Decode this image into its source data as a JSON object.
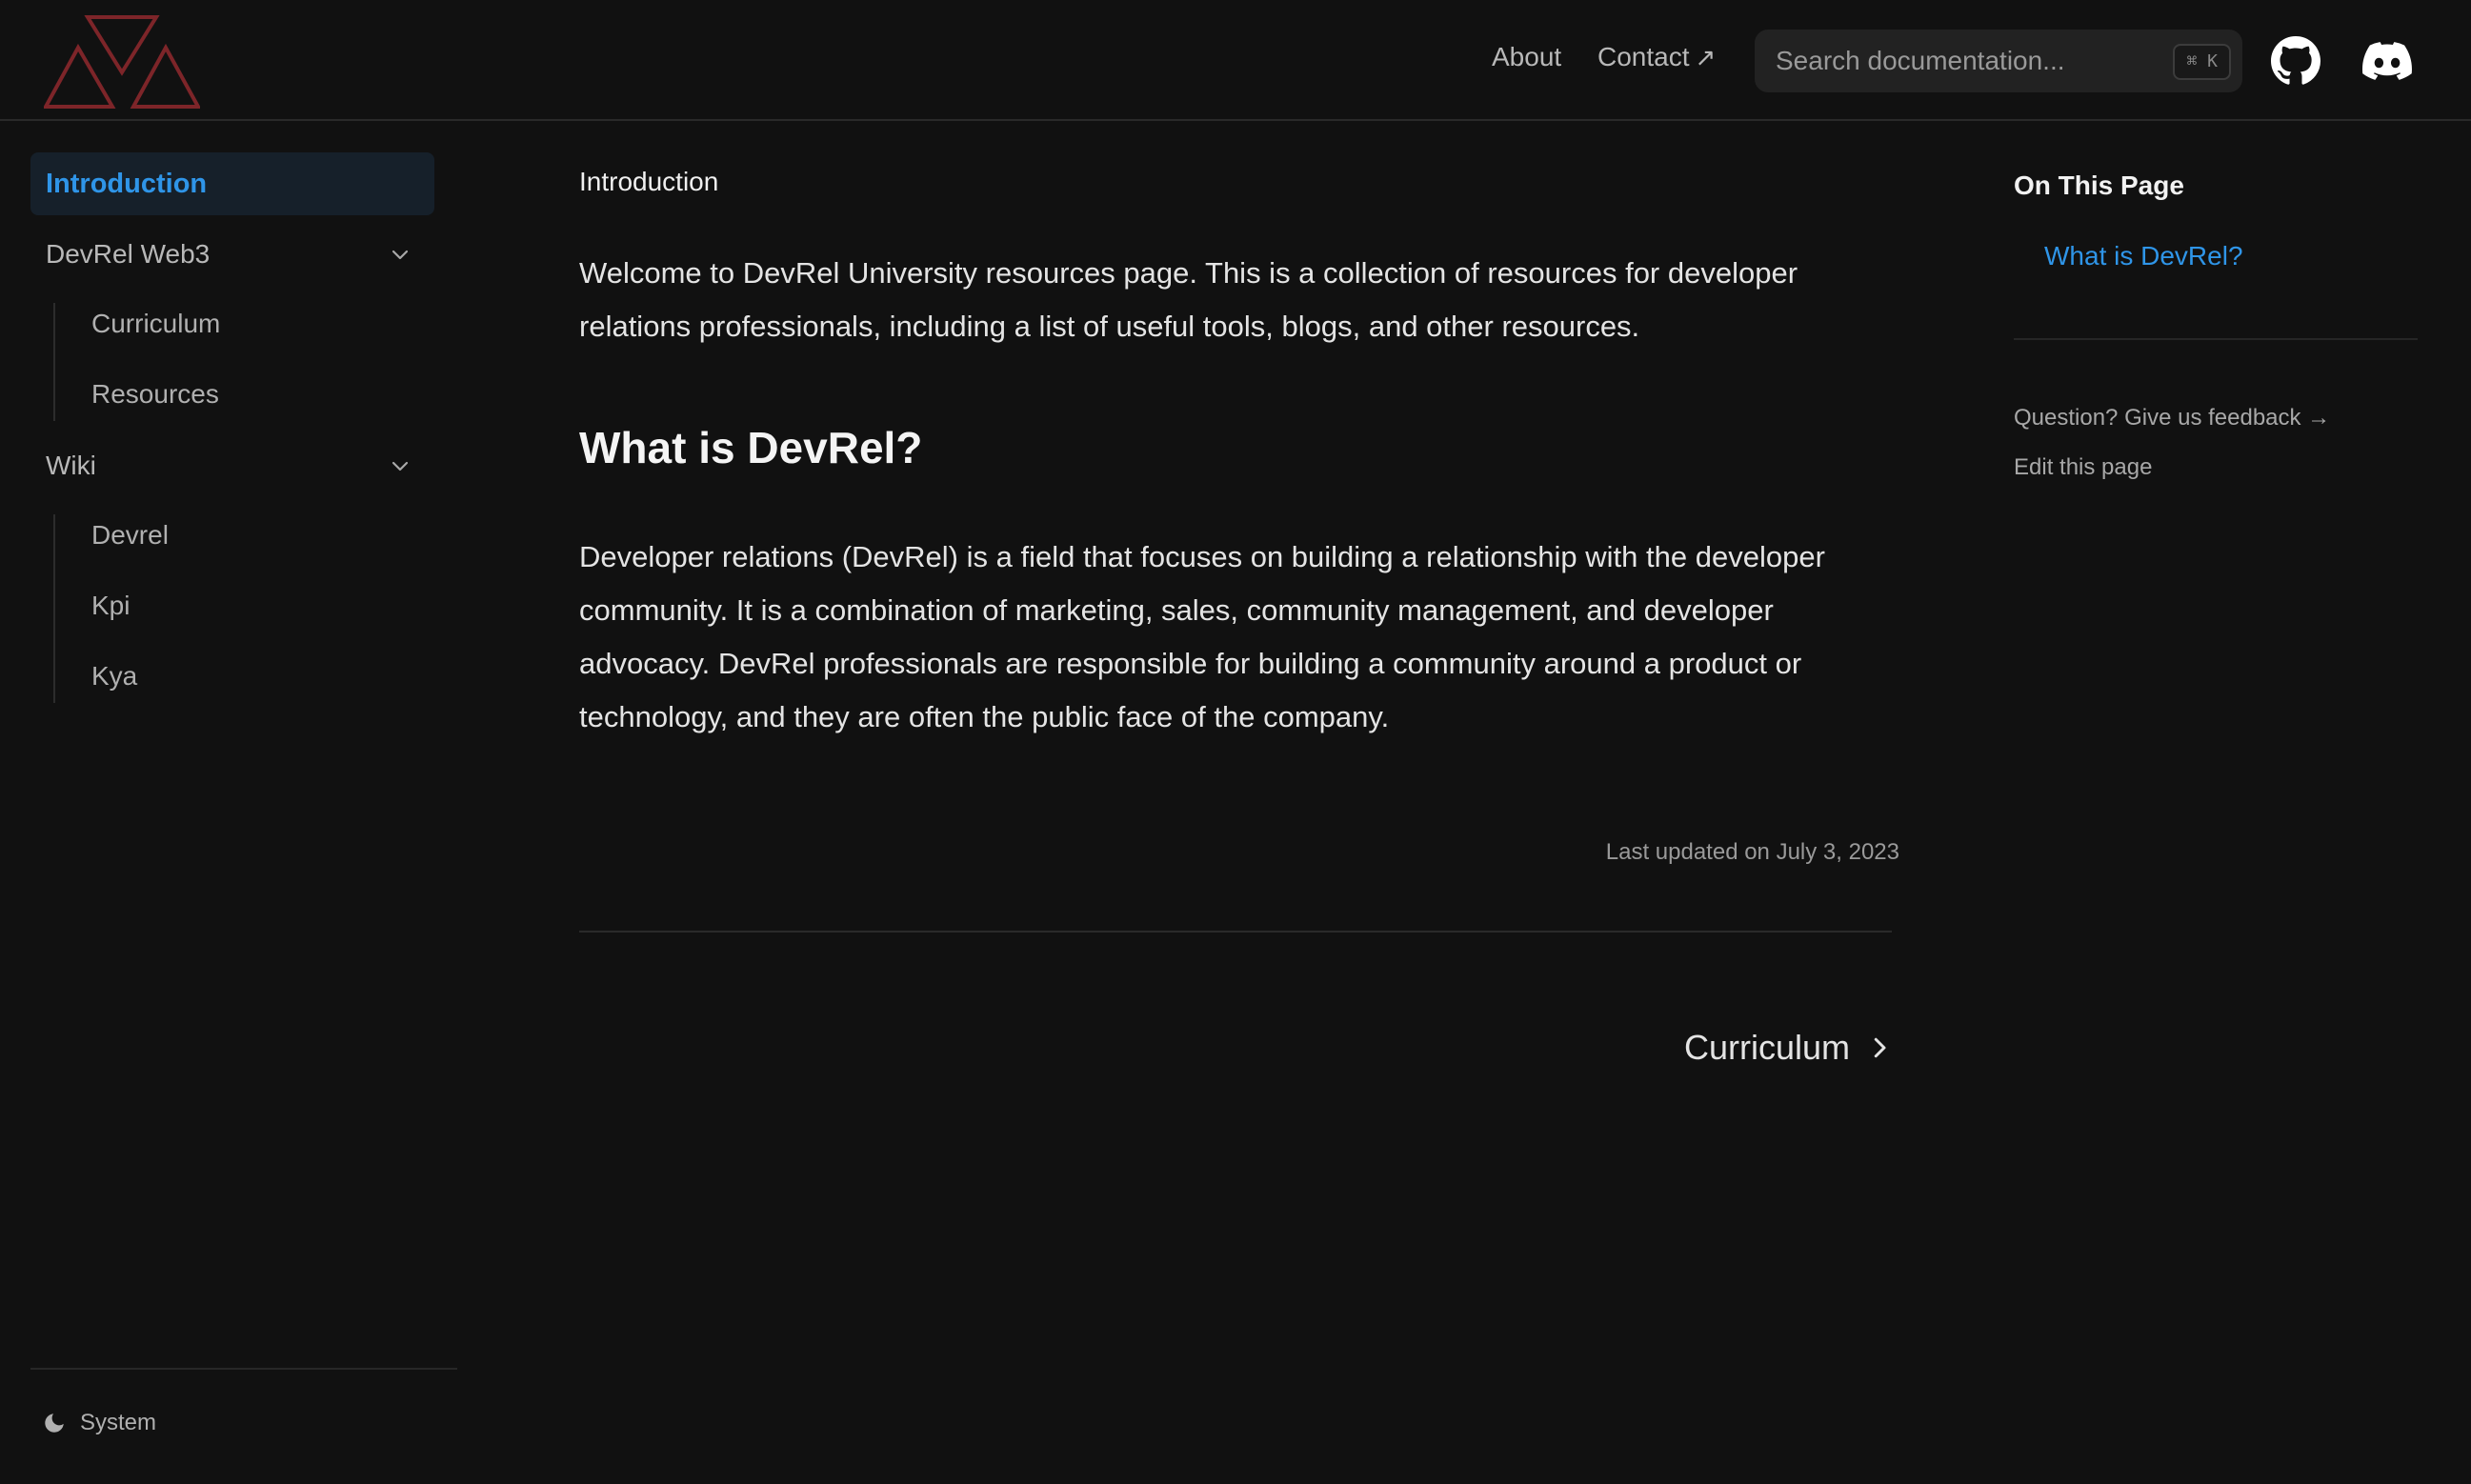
{
  "header": {
    "nav": {
      "about": "About",
      "contact": "Contact",
      "contact_arrow": "↗"
    },
    "search": {
      "placeholder": "Search documentation...",
      "shortcut": "⌘ K"
    },
    "icons": {
      "github": "github-icon",
      "discord": "discord-icon"
    },
    "logo_color": "#7d2529"
  },
  "sidebar": {
    "active": "Introduction",
    "groups": [
      {
        "label": "DevRel Web3",
        "items": [
          "Curriculum",
          "Resources"
        ]
      },
      {
        "label": "Wiki",
        "items": [
          "Devrel",
          "Kpi",
          "Kya"
        ]
      }
    ],
    "theme": "System"
  },
  "main": {
    "breadcrumb": "Introduction",
    "intro": "Welcome to DevRel University resources page. This is a collection of resources for developer relations professionals, including a list of useful tools, blogs, and other resources.",
    "heading": "What is DevRel?",
    "body": "Developer relations (DevRel) is a field that focuses on building a relationship with the developer community. It is a combination of marketing, sales, community management, and developer advocacy. DevRel professionals are responsible for building a community around a product or technology, and they are often the public face of the company.",
    "last_updated": "Last updated on July 3, 2023",
    "next": "Curriculum"
  },
  "toc": {
    "title": "On This Page",
    "links": [
      "What is DevRel?"
    ],
    "feedback": "Question? Give us feedback →",
    "edit": "Edit this page"
  },
  "colors": {
    "accent": "#2f95e8",
    "background": "#111111",
    "active_bg": "#16202a"
  }
}
